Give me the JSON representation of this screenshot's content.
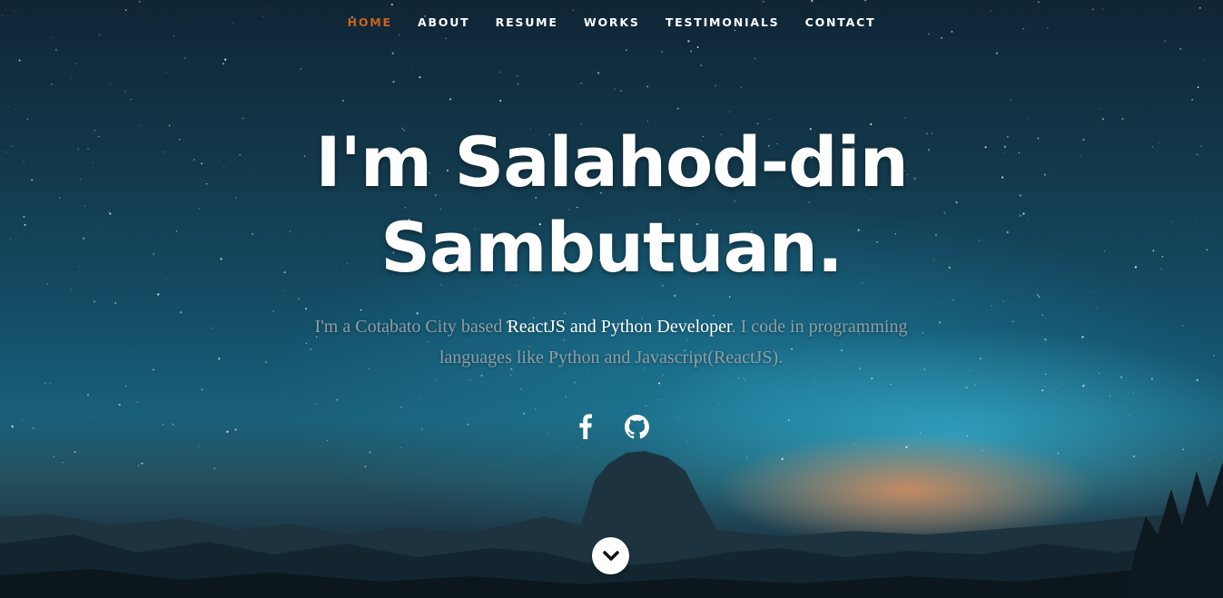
{
  "nav": {
    "items": [
      {
        "label": "HOME",
        "active": true
      },
      {
        "label": "ABOUT",
        "active": false
      },
      {
        "label": "RESUME",
        "active": false
      },
      {
        "label": "WORKS",
        "active": false
      },
      {
        "label": "TESTIMONIALS",
        "active": false
      },
      {
        "label": "CONTACT",
        "active": false
      }
    ],
    "active_color": "#cf6217"
  },
  "hero": {
    "headline_line1": "I'm Salahod-din",
    "headline_line2": "Sambutuan.",
    "intro_part1": "I'm a Cotabato City based ",
    "intro_highlight": "ReactJS and Python Developer",
    "intro_part2": ". I code in programming languages like Python and Javascript(ReactJS)."
  },
  "social": [
    {
      "icon": "facebook-icon"
    },
    {
      "icon": "github-icon"
    }
  ],
  "scroll_button": {
    "icon": "chevron-down-icon"
  }
}
